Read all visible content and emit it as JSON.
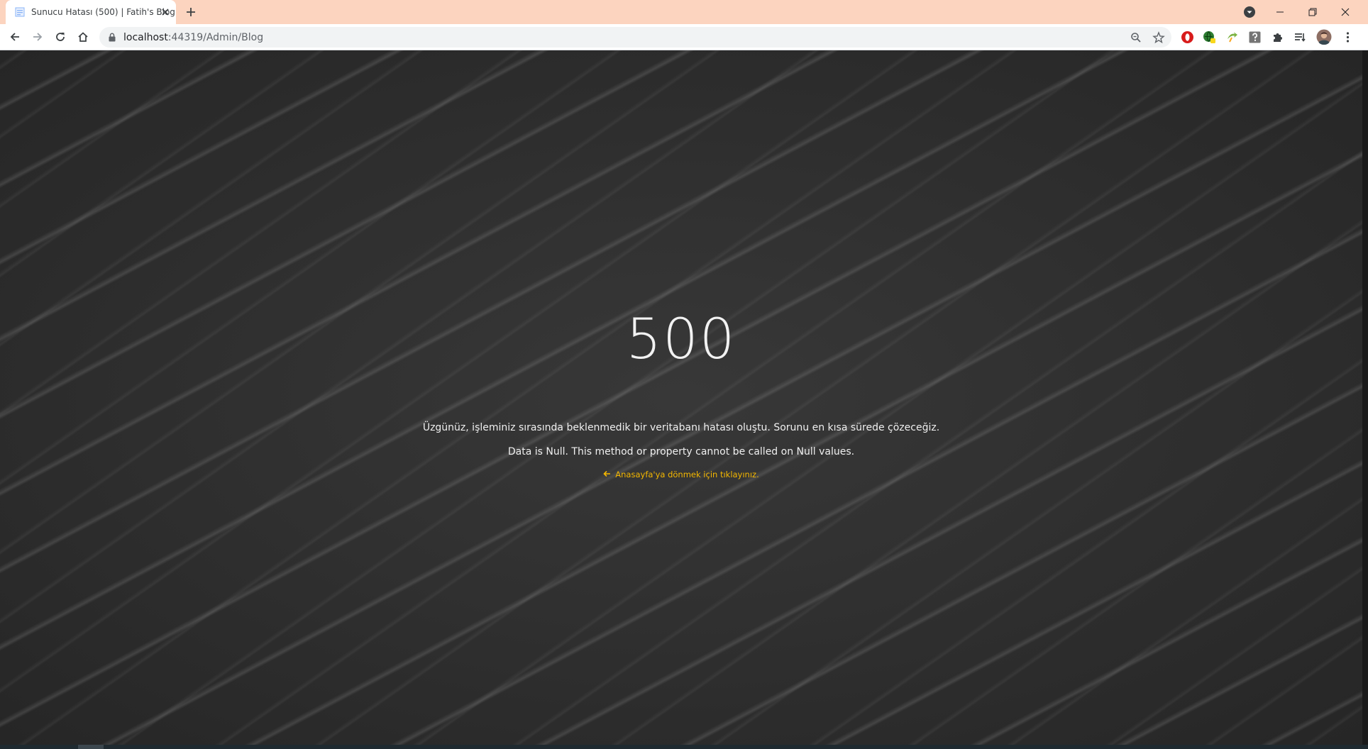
{
  "browser": {
    "tab": {
      "title": "Sunucu Hatası (500) | Fatih's Blog"
    },
    "address": {
      "host": "localhost",
      "rest": ":44319/Admin/Blog"
    }
  },
  "error": {
    "code": "500",
    "message": "Üzgünüz, işleminiz sırasında beklenmedik bir veritabanı hatası oluştu. Sorunu en kısa sürede çözeceğiz.",
    "detail": "Data is Null. This method or property cannot be called on Null values.",
    "home_link": "Anasayfa'ya dönmek için tıklayınız.",
    "link_color": "#f5b800"
  }
}
